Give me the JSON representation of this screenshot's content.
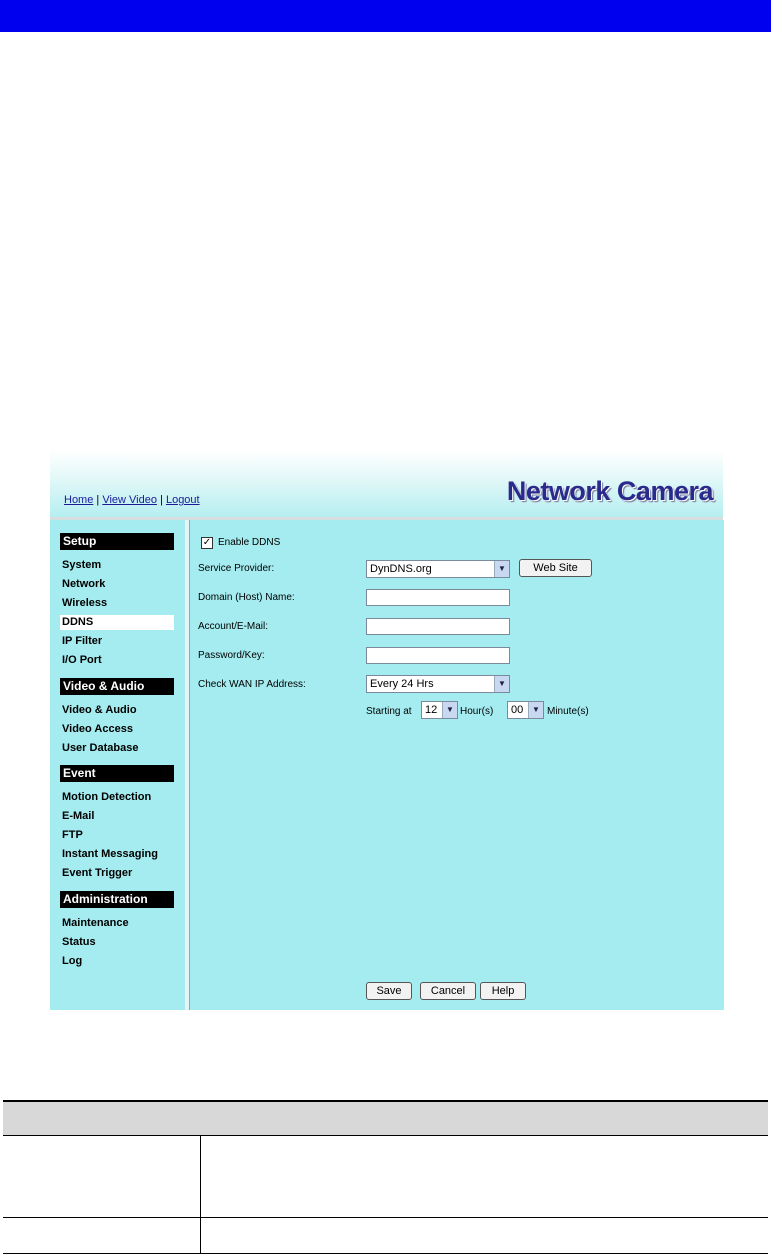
{
  "header": {
    "links": [
      {
        "label": "Home"
      },
      {
        "label": "View Video"
      },
      {
        "label": "Logout"
      }
    ],
    "brand": "Network Camera"
  },
  "sidebar": {
    "sections": [
      {
        "title": "Setup",
        "items": [
          "System",
          "Network",
          "Wireless",
          "DDNS",
          "IP Filter",
          "I/O Port"
        ]
      },
      {
        "title": "Video & Audio",
        "items": [
          "Video & Audio",
          "Video Access",
          "User Database"
        ]
      },
      {
        "title": "Event",
        "items": [
          "Motion Detection",
          "E-Mail",
          "FTP",
          "Instant Messaging",
          "Event Trigger"
        ]
      },
      {
        "title": "Administration",
        "items": [
          "Maintenance",
          "Status",
          "Log"
        ]
      }
    ],
    "active_item": "DDNS"
  },
  "form": {
    "enable_label": "Enable DDNS",
    "enable_checked": true,
    "service_provider_label": "Service Provider:",
    "service_provider_value": "DynDNS.org",
    "web_site_button": "Web Site",
    "domain_label": "Domain (Host) Name:",
    "domain_value": "",
    "account_label": "Account/E-Mail:",
    "account_value": "",
    "password_label": "Password/Key:",
    "password_value": "",
    "check_wan_label": "Check WAN IP Address:",
    "check_wan_value": "Every 24 Hrs",
    "starting_at_label": "Starting at",
    "hour_value": "12",
    "hour_label": "Hour(s)",
    "minute_value": "00",
    "minute_label": "Minute(s)",
    "save_button": "Save",
    "cancel_button": "Cancel",
    "help_button": "Help"
  },
  "colors": {
    "top_bar": "#0000ee",
    "panel_bg": "#a4ecf0",
    "section_header": "#000000"
  }
}
